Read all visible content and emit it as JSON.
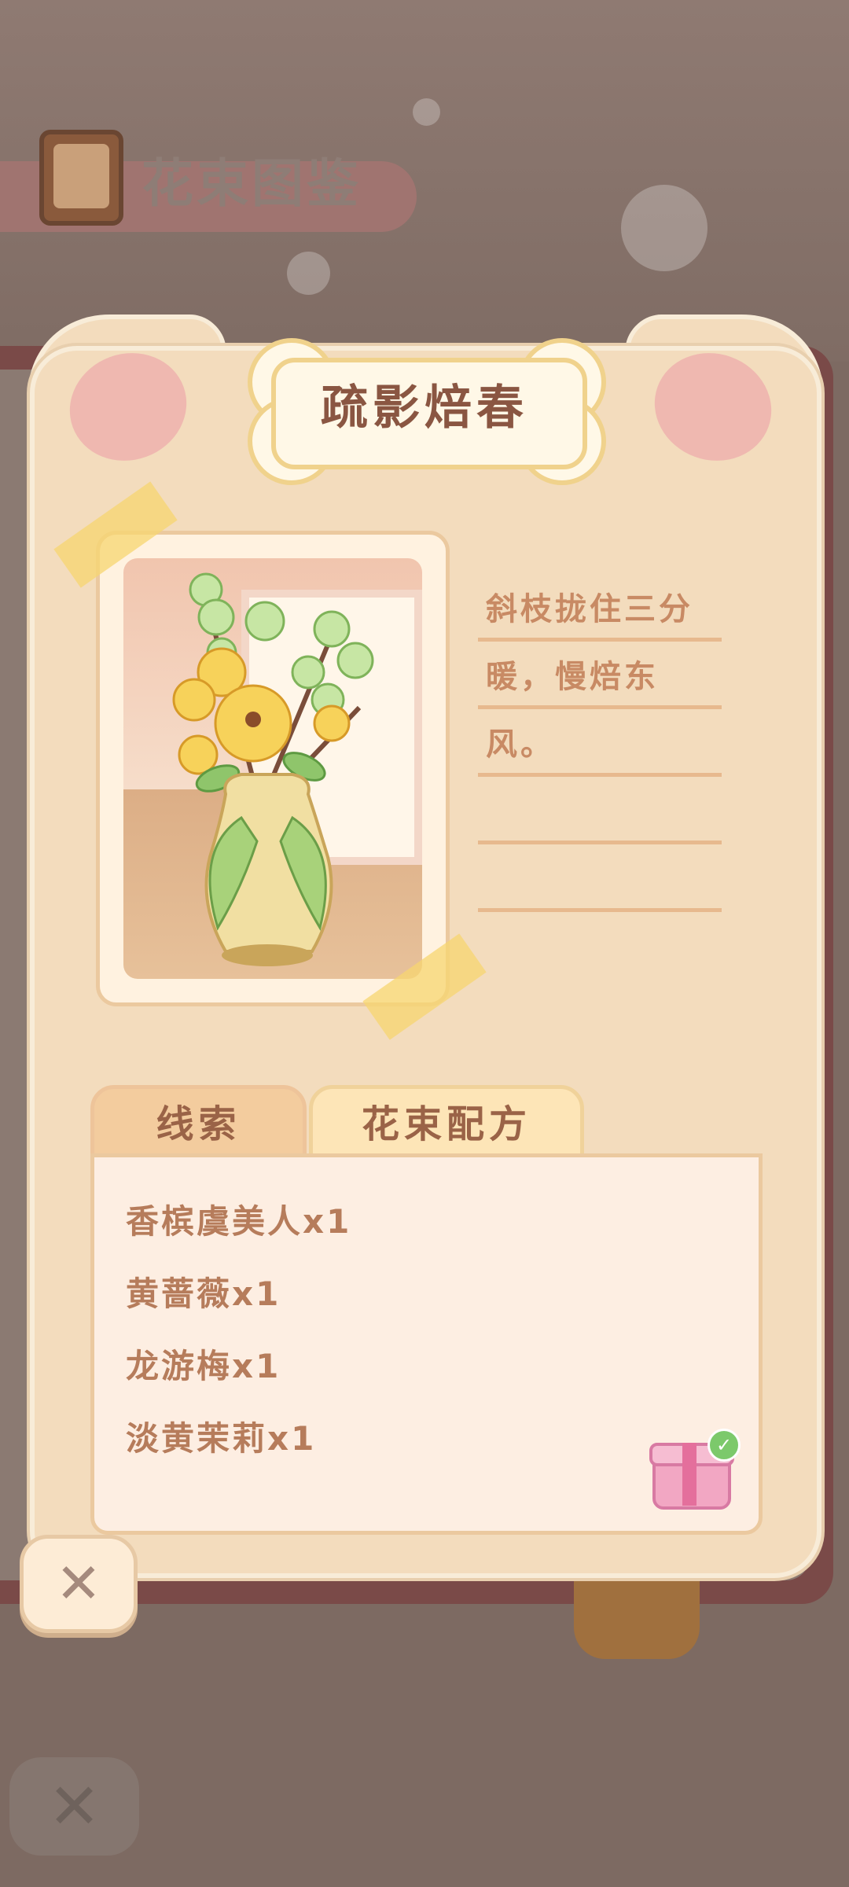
{
  "header": {
    "title": "花束图鉴"
  },
  "card": {
    "title": "疏影焙春",
    "description_lines": [
      "斜枝拢住三分",
      "暖，慢焙东",
      "风。",
      "",
      ""
    ]
  },
  "tabs": [
    {
      "label": "线索",
      "active": false
    },
    {
      "label": "花束配方",
      "active": true
    }
  ],
  "recipe": {
    "items": [
      "香槟虞美人x1",
      "黄蔷薇x1",
      "龙游梅x1",
      "淡黄茉莉x1"
    ]
  },
  "icons": {
    "close": "close-icon",
    "gift": "gift-icon",
    "check": "check-icon",
    "book": "book-icon"
  },
  "colors": {
    "card_bg": "#f3dcbd",
    "title_text": "#8a5642",
    "recipe_text": "#b67c5b",
    "ear_inner": "#efb8b0",
    "gift_check": "#7cc96b"
  }
}
